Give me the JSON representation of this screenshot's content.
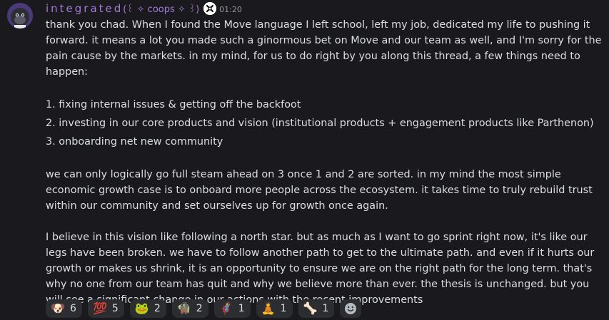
{
  "message": {
    "author": "integrated",
    "author_suffix": "(꒰ ✧ coops ✧ ꒱)",
    "timestamp": "01:20",
    "paragraphs": [
      "thank you chad. When I found the Move language I left school, left my job, dedicated my life to pushing it forward. it means a lot you made such a ginormous bet on Move and our team as well, and I'm sorry for the pain cause by the markets. in my mind, for us to do right by you along this thread, a few things need to happen:",
      "we can only logically go full steam ahead on 3 once 1 and 2 are sorted. in my mind the most simple economic growth case is to onboard more people across the ecosystem. it takes time to truly rebuild trust within our community and set ourselves up for growth once again.",
      "I believe in this vision like following a north star. but as much as I want to go sprint right now, it's like our legs have been broken. we have to follow another path to get to the ultimate path. and even if it hurts our growth or makes us shrink, it is an opportunity to ensure we are on the right path for the long term. that's why no one from our team has quit and why we believe more than ever. the thesis is unchanged. but you will see a significant change in our actions with the recent improvements"
    ],
    "list": [
      "1. fixing internal issues & getting off the backfoot",
      "2. investing in our core products and vision (institutional products + engagement products like Parthenon)",
      "3. onboarding net new community"
    ]
  },
  "reactions": [
    {
      "icon": "dog-icon",
      "glyph": "🐶",
      "count": "6"
    },
    {
      "icon": "hundred-points-icon",
      "glyph": "💯",
      "count": "5"
    },
    {
      "icon": "frog-icon",
      "glyph": "🐸",
      "count": "2"
    },
    {
      "icon": "goblin-icon",
      "glyph": "🧌",
      "count": "2"
    },
    {
      "icon": "superhero-icon",
      "glyph": "🦸",
      "count": "1"
    },
    {
      "icon": "person-icon",
      "glyph": "🧘",
      "count": "1"
    },
    {
      "icon": "skeleton-icon",
      "glyph": "🦴",
      "count": "1"
    }
  ],
  "colors": {
    "background": "#1a1a1e",
    "username": "#a57bd6",
    "text": "#dbdee1",
    "timestamp": "#949ba4",
    "reaction_bg": "#2b2d31"
  }
}
